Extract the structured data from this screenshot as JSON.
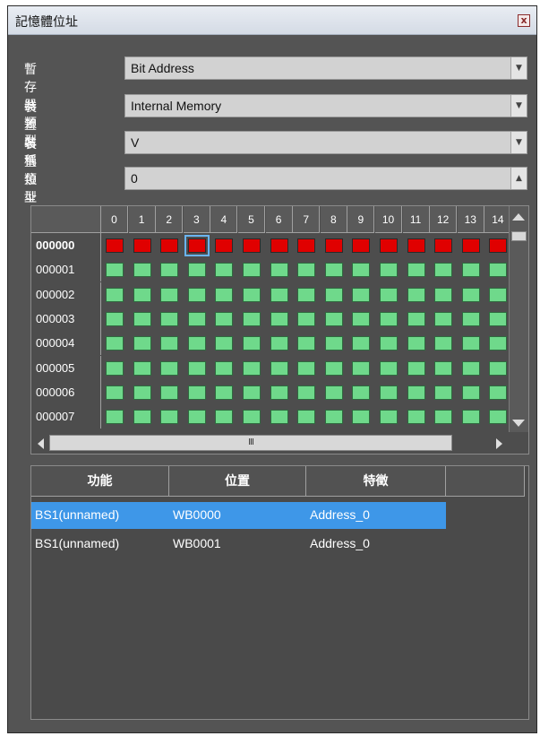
{
  "window": {
    "title": "記憶體位址",
    "close_label": "x"
  },
  "form": {
    "register_type": {
      "label": "暫存器類型",
      "value": "Bit Address"
    },
    "device_name": {
      "label": "裝置名稱",
      "value": "Internal Memory"
    },
    "device_type": {
      "label": "裝置類型",
      "value": "V"
    },
    "address": {
      "label": "位址",
      "value": "0"
    }
  },
  "bit_grid": {
    "columns": [
      "0",
      "1",
      "2",
      "3",
      "4",
      "5",
      "6",
      "7",
      "8",
      "9",
      "10",
      "11",
      "12",
      "13",
      "14"
    ],
    "rows": [
      "000000",
      "000001",
      "000002",
      "000003",
      "000004",
      "000005",
      "000006",
      "000007"
    ],
    "selected_row": "000000",
    "selected_column": "3",
    "colors": {
      "on": "#e00000",
      "off": "#6fd98b",
      "selection": "#6ab4f1"
    },
    "states": [
      [
        1,
        1,
        1,
        1,
        1,
        1,
        1,
        1,
        1,
        1,
        1,
        1,
        1,
        1,
        1
      ],
      [
        0,
        0,
        0,
        0,
        0,
        0,
        0,
        0,
        0,
        0,
        0,
        0,
        0,
        0,
        0
      ],
      [
        0,
        0,
        0,
        0,
        0,
        0,
        0,
        0,
        0,
        0,
        0,
        0,
        0,
        0,
        0
      ],
      [
        0,
        0,
        0,
        0,
        0,
        0,
        0,
        0,
        0,
        0,
        0,
        0,
        0,
        0,
        0
      ],
      [
        0,
        0,
        0,
        0,
        0,
        0,
        0,
        0,
        0,
        0,
        0,
        0,
        0,
        0,
        0
      ],
      [
        0,
        0,
        0,
        0,
        0,
        0,
        0,
        0,
        0,
        0,
        0,
        0,
        0,
        0,
        0
      ],
      [
        0,
        0,
        0,
        0,
        0,
        0,
        0,
        0,
        0,
        0,
        0,
        0,
        0,
        0,
        0
      ],
      [
        0,
        0,
        0,
        0,
        0,
        0,
        0,
        0,
        0,
        0,
        0,
        0,
        0,
        0,
        0
      ]
    ],
    "hscroll_grip": "III"
  },
  "list": {
    "headers": [
      "功能",
      "位置",
      "特徵"
    ],
    "rows": [
      {
        "function": "BS1(unnamed)",
        "position": "WB0000",
        "feature": "Address_0",
        "selected": true
      },
      {
        "function": "BS1(unnamed)",
        "position": "WB0001",
        "feature": "Address_0",
        "selected": false
      }
    ],
    "colors": {
      "selected_row": "#3e97e8"
    }
  }
}
